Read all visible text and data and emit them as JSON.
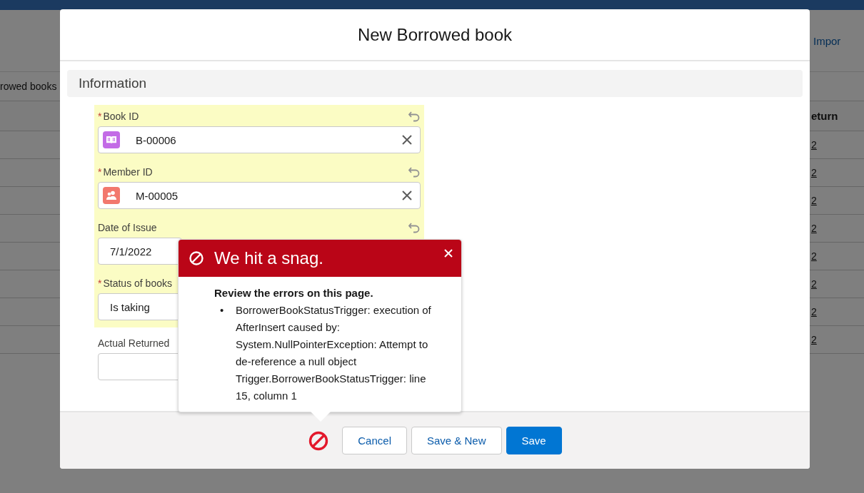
{
  "background": {
    "tab": "Impor",
    "list_title": "rowed books",
    "column_header": "eturn",
    "rows": [
      "2",
      "2",
      "2",
      "2",
      "2",
      "2",
      "2",
      "2"
    ]
  },
  "modal": {
    "title": "New Borrowed book",
    "section": "Information",
    "fields": [
      {
        "label": "Book ID",
        "required_mark": "*",
        "highlighted": true,
        "undo": true,
        "kind": "lookup",
        "color": "#c36be6",
        "value": "B-00006"
      },
      {
        "label": "Member ID",
        "required_mark": "*",
        "highlighted": true,
        "undo": true,
        "kind": "lookup",
        "color": "#f2786d",
        "value": "M-00005"
      },
      {
        "label": "Date of Issue",
        "highlighted": true,
        "undo": true,
        "kind": "date",
        "value": "7/1/2022"
      },
      {
        "label": "Status of books",
        "required_mark": "*",
        "highlighted": true,
        "undo": false,
        "kind": "picklist",
        "value": "Is taking"
      },
      {
        "label": "Actual Returned",
        "highlighted": false,
        "kind": "date"
      }
    ],
    "error_popover": {
      "title": "We hit a snag.",
      "heading": "Review the errors on this page.",
      "errors": [
        {
          "bullet": "•",
          "text": "BorrowerBookStatusTrigger: execution of AfterInsert caused by: System.NullPointerException: Attempt to de-reference a null object Trigger.BorrowerBookStatusTrigger: line 15, column 1"
        }
      ]
    },
    "buttons": [
      {
        "label": "Cancel",
        "kind": "neutral"
      },
      {
        "label": "Save & New",
        "kind": "neutral"
      },
      {
        "label": "Save",
        "kind": "brand"
      }
    ]
  }
}
